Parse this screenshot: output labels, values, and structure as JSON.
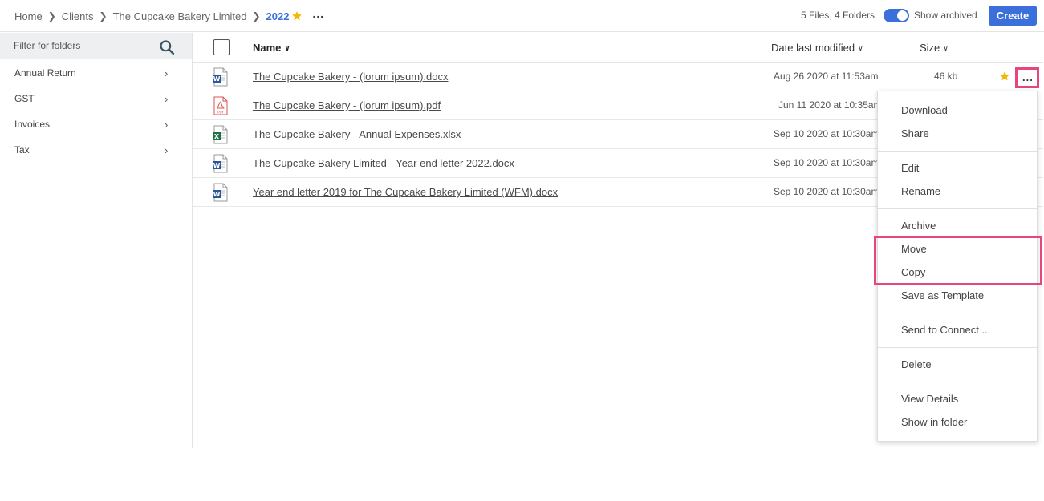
{
  "breadcrumb": {
    "items": [
      "Home",
      "Clients",
      "The Cupcake Bakery Limited"
    ],
    "current": "2022",
    "more": "..."
  },
  "header": {
    "file_count": "5 Files, 4 Folders",
    "show_archived_label": "Show archived",
    "create_label": "Create"
  },
  "sidebar": {
    "filter_placeholder": "Filter for folders",
    "folders": [
      "Annual Return",
      "GST",
      "Invoices",
      "Tax"
    ]
  },
  "table": {
    "columns": {
      "name": "Name",
      "date": "Date last modified",
      "size": "Size"
    },
    "rows": [
      {
        "type": "word",
        "name": "The Cupcake Bakery - (lorum ipsum).docx",
        "date": "Aug 26 2020 at 11:53am",
        "size": "46 kb"
      },
      {
        "type": "pdf",
        "name": "The Cupcake Bakery - (lorum ipsum).pdf",
        "date": "Jun 11 2020 at 10:35am",
        "size": ""
      },
      {
        "type": "excel",
        "name": "The Cupcake Bakery - Annual Expenses.xlsx",
        "date": "Sep 10 2020 at 10:30am",
        "size": ""
      },
      {
        "type": "word",
        "name": "The Cupcake Bakery Limited - Year end letter 2022.docx",
        "date": "Sep 10 2020 at 10:30am",
        "size": ""
      },
      {
        "type": "word",
        "name": "Year end letter 2019 for The Cupcake Bakery Limited (WFM).docx",
        "date": "Sep 10 2020 at 10:30am",
        "size": ""
      }
    ],
    "row_more": "..."
  },
  "context_menu": {
    "groups": [
      [
        "Download",
        "Share"
      ],
      [
        "Edit",
        "Rename"
      ],
      [
        "Archive",
        "Move",
        "Copy",
        "Save as Template"
      ],
      [
        "Send to Connect ..."
      ],
      [
        "Delete"
      ],
      [
        "View Details",
        "Show in folder"
      ]
    ]
  },
  "colors": {
    "accent": "#3b6fd9",
    "star": "#f5b800",
    "highlight": "#e8457a"
  }
}
